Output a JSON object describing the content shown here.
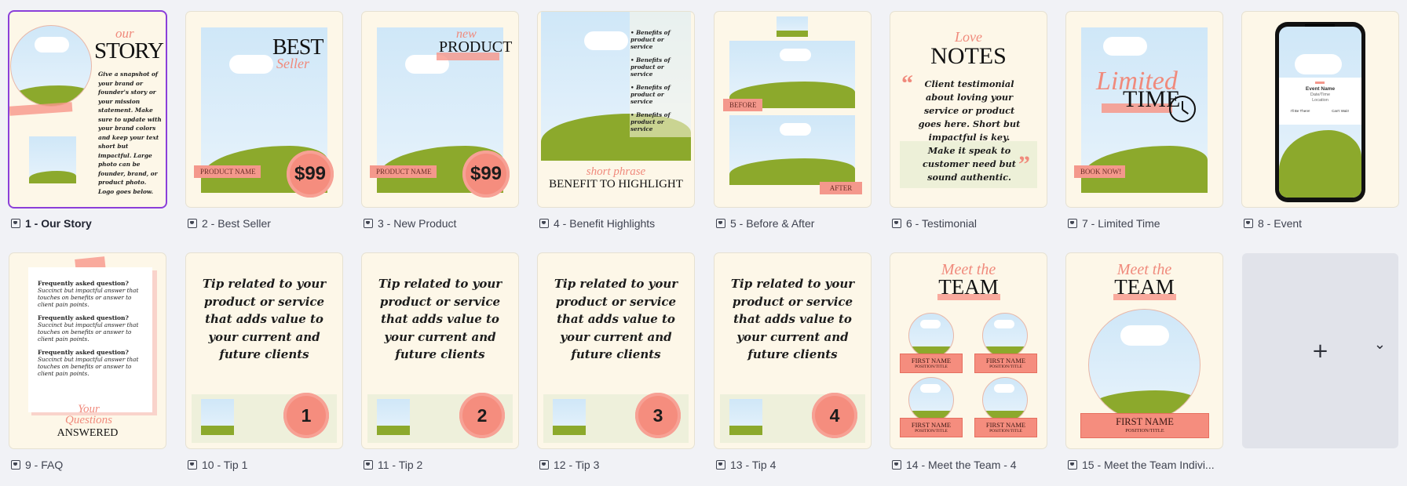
{
  "pages": [
    {
      "caption": "1 - Our Story",
      "selected": true
    },
    {
      "caption": "2 - Best Seller"
    },
    {
      "caption": "3 - New Product"
    },
    {
      "caption": "4 - Benefit Highlights"
    },
    {
      "caption": "5 - Before & After"
    },
    {
      "caption": "6 - Testimonial"
    },
    {
      "caption": "7 - Limited Time"
    },
    {
      "caption": "8 - Event"
    },
    {
      "caption": "9 - FAQ"
    },
    {
      "caption": "10 - Tip 1"
    },
    {
      "caption": "11 - Tip 2"
    },
    {
      "caption": "12 - Tip 3"
    },
    {
      "caption": "13 - Tip 4"
    },
    {
      "caption": "14 - Meet the Team - 4"
    },
    {
      "caption": "15 - Meet the Team Indivi..."
    }
  ],
  "t1": {
    "script": "our",
    "title": "STORY",
    "body": "Give a snapshot of your brand or founder's story or your mission statement. Make sure to update with your brand colors and keep your text short but impactful. Large photo can be founder, brand, or product photo. Logo goes below."
  },
  "t2": {
    "title": "BEST",
    "script": "Seller",
    "tag": "PRODUCT NAME",
    "price": "$99"
  },
  "t3": {
    "script": "new",
    "title": "PRODUCT",
    "tag": "PRODUCT NAME",
    "price": "$99"
  },
  "t4": {
    "bullet": "Benefits of product or service",
    "script": "short phrase",
    "title": "BENEFIT TO HIGHLIGHT"
  },
  "t5": {
    "before": "BEFORE",
    "after": "AFTER"
  },
  "t6": {
    "script": "Love",
    "title": "NOTES",
    "body": "Client testimonial about loving your service or product goes here. Short but impactful is key. Make it speak to customer need but sound authentic."
  },
  "t7": {
    "script": "Limited",
    "title": "TIME",
    "tag": "BOOK NOW!"
  },
  "t8": {
    "event_name": "Event Name",
    "datetime": "Date/Time",
    "location": "Location",
    "btn_yes": "I'll Be There!",
    "btn_no": "Can't Wait!"
  },
  "t9": {
    "q": "Frequently asked question?",
    "a": "Succinct but impactful answer that touches on benefits or answer to client pain points.",
    "script": "Your Questions",
    "title": "ANSWERED"
  },
  "tip_text": "Tip related to your product or service that adds value to your current and future clients",
  "tip_numbers": [
    "1",
    "2",
    "3",
    "4"
  ],
  "t14": {
    "script": "Meet the",
    "title": "TEAM",
    "name": "FIRST NAME",
    "pos": "POSITION/TITLE"
  },
  "t15": {
    "script": "Meet the",
    "title": "TEAM",
    "name": "FIRST NAME",
    "pos": "POSITION/TITLE"
  },
  "add_page": {
    "plus": "+",
    "chevron": "⌄"
  }
}
